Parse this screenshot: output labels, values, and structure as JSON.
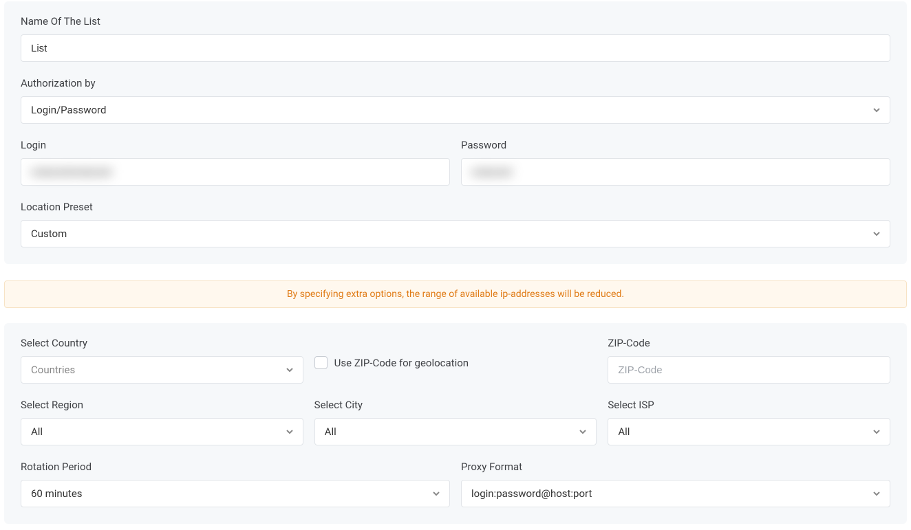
{
  "panel1": {
    "name_label": "Name Of The List",
    "name_value": "List",
    "auth_label": "Authorization by",
    "auth_value": "Login/Password",
    "login_label": "Login",
    "login_value": "",
    "password_label": "Password",
    "password_value": "",
    "preset_label": "Location Preset",
    "preset_value": "Custom"
  },
  "alert_text": "By specifying extra options, the range of available ip-addresses will be reduced.",
  "panel2": {
    "country_label": "Select Country",
    "country_value": "Countries",
    "zip_checkbox_label": "Use ZIP-Code for geolocation",
    "zip_label": "ZIP-Code",
    "zip_placeholder": "ZIP-Code",
    "region_label": "Select Region",
    "region_value": "All",
    "city_label": "Select City",
    "city_value": "All",
    "isp_label": "Select ISP",
    "isp_value": "All",
    "rotation_label": "Rotation Period",
    "rotation_value": "60 minutes",
    "format_label": "Proxy Format",
    "format_value": "login:password@host:port"
  }
}
